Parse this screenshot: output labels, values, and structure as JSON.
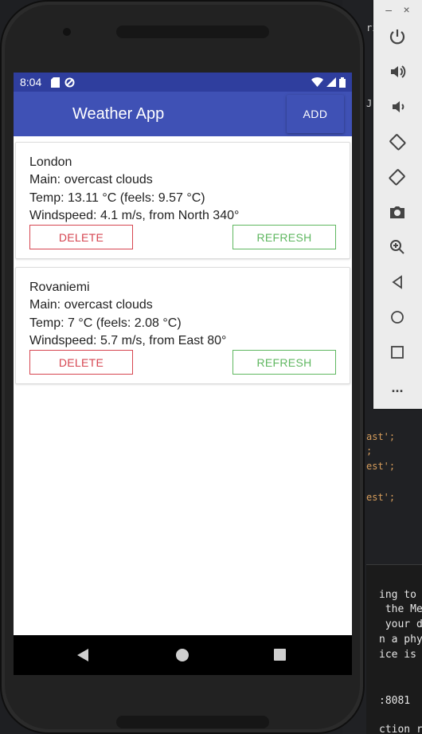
{
  "statusbar": {
    "time": "8:04"
  },
  "appbar": {
    "title": "Weather App",
    "add_label": "ADD"
  },
  "cards": [
    {
      "city": "London",
      "main": "Main: overcast clouds",
      "temp": "Temp: 13.11 °C (feels: 9.57 °C)",
      "wind": "Windspeed: 4.1 m/s, from North 340°",
      "delete_label": "DELETE",
      "refresh_label": "REFRESH"
    },
    {
      "city": "Rovaniemi",
      "main": "Main: overcast clouds",
      "temp": "Temp: 7 °C (feels: 2.08 °C)",
      "wind": "Windspeed: 5.7 m/s, from East 80°",
      "delete_label": "DELETE",
      "refresh_label": "REFRESH"
    }
  ],
  "emulator_toolbar": {
    "minimize": "–",
    "close": "×",
    "tools": [
      "power-icon",
      "volume-up-icon",
      "volume-down-icon",
      "rotate-left-icon",
      "rotate-right-icon",
      "camera-icon",
      "zoom-icon",
      "back-icon",
      "home-icon",
      "overview-icon",
      "more-icon"
    ],
    "more_label": "..."
  },
  "editor_background": {
    "code_lines": [
      "ri",
      "J",
      "ast';",
      ";",
      "est';",
      "est';"
    ],
    "terminal_lines": [
      "ing to fi",
      " the Metro",
      " your devi",
      "n a physic",
      "ice is on",
      ":8081",
      "ction reset"
    ]
  },
  "colors": {
    "primary": "#3f51b5",
    "primary_dark": "#2f3e9e",
    "delete": "#d64550",
    "refresh": "#5fb760"
  }
}
